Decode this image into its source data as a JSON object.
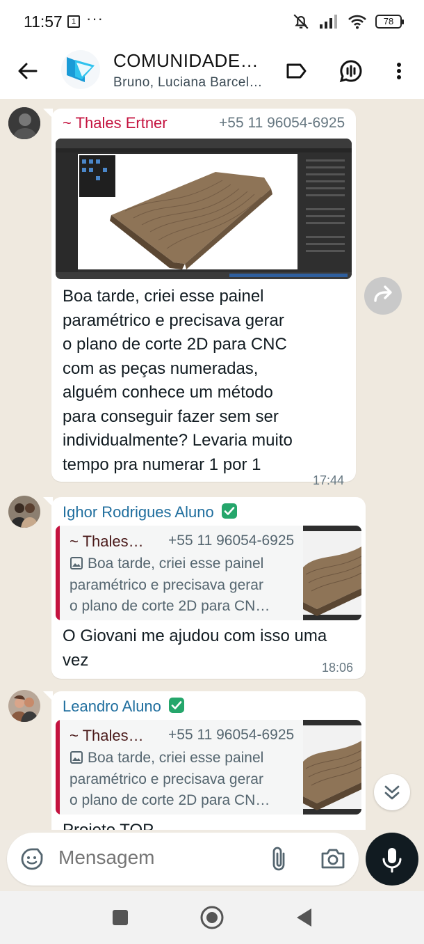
{
  "status_bar": {
    "time": "11:57",
    "notification_glyph": "1",
    "dots": "···",
    "battery": "78"
  },
  "header": {
    "title": "COMUNIDADE…",
    "subtitle": "Bruno, Luciana Barcel…"
  },
  "messages": [
    {
      "sender": "~ Thales Ertner",
      "phone": "+55 11 96054-6925",
      "text_lines": [
        "Boa tarde, criei esse painel",
        "paramétrico e precisava gerar",
        "o plano de corte 2D para CNC",
        "com as peças numeradas,",
        "alguém conhece um método",
        "para conseguir fazer sem ser",
        "individualmente? Levaria muito",
        "tempo pra numerar 1 por 1"
      ],
      "time": "17:44"
    },
    {
      "sender": "Ighor Rodrigues Aluno",
      "quote": {
        "name": "~ Thales…",
        "phone": "+55 11 96054-6925",
        "lines": [
          "Boa tarde, criei esse painel",
          "paramétrico e precisava gerar",
          "o plano de corte 2D para CN…"
        ]
      },
      "text_lines": [
        "O Giovani me ajudou com isso uma",
        "vez"
      ],
      "time": "18:06"
    },
    {
      "sender": "Leandro Aluno",
      "quote": {
        "name": "~ Thales…",
        "phone": "+55 11 96054-6925",
        "lines": [
          "Boa tarde, criei esse painel",
          "paramétrico e precisava gerar",
          "o plano de corte 2D para CN…"
        ]
      },
      "text_partial": "Projeto TOP"
    }
  ],
  "input": {
    "placeholder": "Mensagem"
  },
  "colors": {
    "sender1": "#c4133f",
    "sender2": "#1f6e9e",
    "verified": "#25a66b",
    "mic_bg": "#111b21"
  },
  "icons": [
    "back-arrow-icon",
    "label-icon",
    "call-icon",
    "more-vert-icon",
    "forward-icon",
    "chevrons-down-icon",
    "sticker-icon",
    "attach-icon",
    "camera-icon",
    "mic-icon",
    "verified-check-icon",
    "image-icon"
  ]
}
